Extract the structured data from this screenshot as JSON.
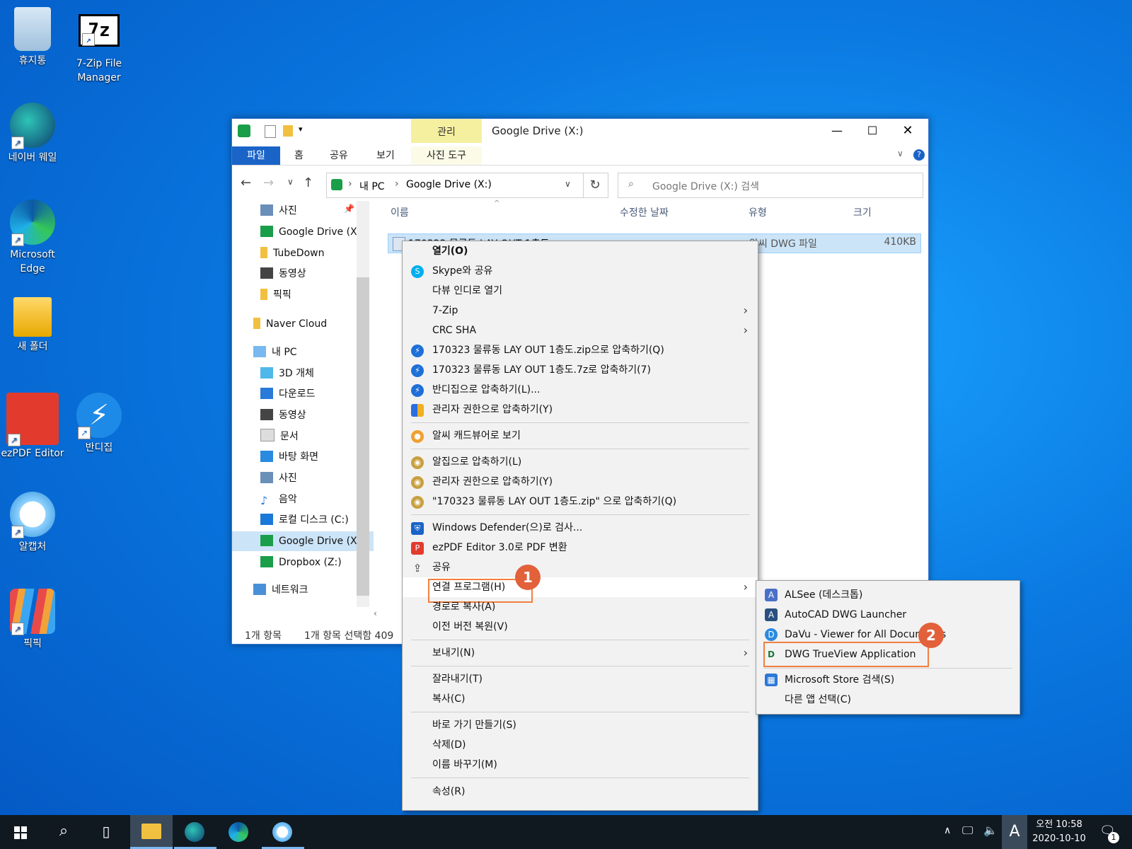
{
  "desktop": {
    "icons": [
      {
        "label": "휴지통"
      },
      {
        "label": "7-Zip File Manager"
      },
      {
        "label": "네이버 웨일"
      },
      {
        "label": "Microsoft Edge"
      },
      {
        "label": "새 폴더"
      },
      {
        "label": "ezPDF Editor"
      },
      {
        "label": "반디집"
      },
      {
        "label": "알캡처"
      },
      {
        "label": "픽픽"
      }
    ]
  },
  "explorer": {
    "title": "Google Drive (X:)",
    "context_tab": "관리",
    "context_tab_sub": "사진 도구",
    "ribbon_tabs": [
      "파일",
      "홈",
      "공유",
      "보기"
    ],
    "breadcrumb": [
      "내 PC",
      "Google Drive (X:)"
    ],
    "search_placeholder": "Google Drive (X:) 검색",
    "columns": [
      "이름",
      "수정한 날짜",
      "유형",
      "크기"
    ],
    "file": {
      "name": "170323 물류동 LAY OUT 1층도",
      "type": "알씨 DWG 파일",
      "size": "410KB"
    },
    "nav": [
      "사진",
      "Google Drive (X",
      "TubeDown",
      "동영상",
      "픽픽",
      "Naver Cloud",
      "내 PC",
      "3D 개체",
      "다운로드",
      "동영상",
      "문서",
      "바탕 화면",
      "사진",
      "음악",
      "로컬 디스크 (C:)",
      "Google Drive (X",
      "Dropbox (Z:)",
      "네트워크"
    ],
    "status_count": "1개 항목",
    "status_selected": "1개 항목 선택함 409"
  },
  "context_menu": {
    "items": [
      "열기(O)",
      "Skype와 공유",
      "다뷰 인디로 열기",
      "7-Zip",
      "CRC SHA",
      "170323 물류동 LAY OUT 1층도.zip으로 압축하기(Q)",
      "170323 물류동 LAY OUT 1층도.7z로 압축하기(7)",
      "반디집으로 압축하기(L)...",
      "관리자 권한으로 압축하기(Y)",
      "알씨 캐드뷰어로 보기",
      "알집으로 압축하기(L)",
      "관리자 권한으로 압축하기(Y)",
      "\"170323 물류동 LAY OUT 1층도.zip\" 으로 압축하기(Q)",
      "Windows Defender(으)로 검사...",
      "ezPDF Editor 3.0로 PDF 변환",
      "공유",
      "연결 프로그램(H)",
      "경로로 복사(A)",
      "이전 버전 복원(V)",
      "보내기(N)",
      "잘라내기(T)",
      "복사(C)",
      "바로 가기 만들기(S)",
      "삭제(D)",
      "이름 바꾸기(M)",
      "속성(R)"
    ]
  },
  "submenu": {
    "items": [
      "ALSee (데스크톱)",
      "AutoCAD DWG Launcher",
      "DaVu - Viewer for All Documents",
      "DWG TrueView Application",
      "Microsoft Store 검색(S)",
      "다른 앱 선택(C)"
    ]
  },
  "annotations": {
    "step1": "1",
    "step2": "2"
  },
  "taskbar": {
    "ime": "A",
    "time": "오전 10:58",
    "date": "2020-10-10",
    "notif_count": "1"
  },
  "colors": {
    "accent": "#1a64c8",
    "highlight": "#e2603a",
    "manage_tab": "#f5f0a0"
  }
}
